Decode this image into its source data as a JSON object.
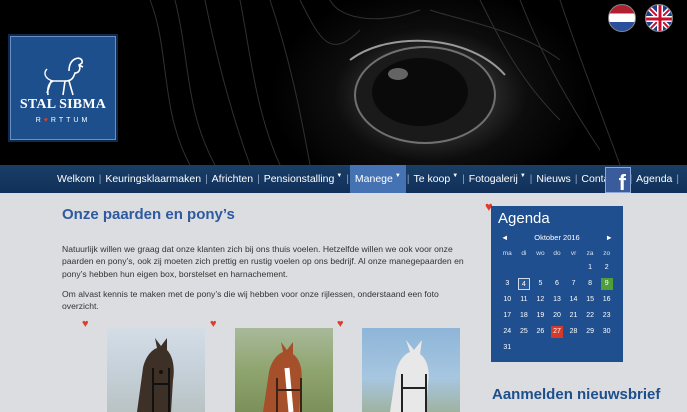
{
  "header": {
    "logo_name": "STAL SIBMA",
    "logo_place": "RTTUM",
    "flags": [
      "nl-flag-icon",
      "uk-flag-icon"
    ]
  },
  "nav": {
    "items": [
      {
        "label": "Welkom",
        "caret": false,
        "active": false
      },
      {
        "label": "Keuringsklaarmaken",
        "caret": false,
        "active": false
      },
      {
        "label": "Africhten",
        "caret": false,
        "active": false
      },
      {
        "label": "Pensionstalling",
        "caret": true,
        "active": false
      },
      {
        "label": "Manege",
        "caret": true,
        "active": true
      },
      {
        "label": "Te koop",
        "caret": true,
        "active": false
      },
      {
        "label": "Fotogalerij",
        "caret": true,
        "active": false
      },
      {
        "label": "Nieuws",
        "caret": false,
        "active": false
      },
      {
        "label": "Contact",
        "caret": true,
        "active": false
      },
      {
        "label": "Agenda",
        "caret": false,
        "active": false
      }
    ],
    "facebook_icon": "f"
  },
  "main": {
    "title": "Onze paarden en pony’s",
    "paragraph1": "Natuurlijk willen we graag dat onze klanten zich bij ons thuis voelen. Hetzelfde willen we ook voor onze paarden en pony’s, ook zij moeten zich prettig en rustig voelen op ons bedrijf. Al onze manegepaarden en pony’s hebben hun eigen box, borstelset en harnachement.",
    "paragraph2": "Om alvast kennis te maken met de pony’s die wij hebben voor onze rijlessen, onderstaand een foto overzicht."
  },
  "agenda": {
    "title": "Agenda",
    "prev": "◄",
    "next": "►",
    "month": "Oktober 2016",
    "weekdays": [
      "ma",
      "di",
      "wo",
      "do",
      "vr",
      "za",
      "zo"
    ],
    "weeks": [
      [
        "",
        "",
        "",
        "",
        "",
        "1",
        "2"
      ],
      [
        "3",
        "4",
        "5",
        "6",
        "7",
        "8",
        "9"
      ],
      [
        "10",
        "11",
        "12",
        "13",
        "14",
        "15",
        "16"
      ],
      [
        "17",
        "18",
        "19",
        "20",
        "21",
        "22",
        "23"
      ],
      [
        "24",
        "25",
        "26",
        "27",
        "28",
        "29",
        "30"
      ],
      [
        "31",
        "",
        "",
        "",
        "",
        "",
        ""
      ]
    ],
    "today": "4",
    "green_day": "9",
    "red_day": "27"
  },
  "newsletter": {
    "title": "Aanmelden nieuwsbrief"
  },
  "colors": {
    "brand_blue": "#1d4f8c",
    "nav_active": "#4572b3",
    "heart": "#e23b2a",
    "title_blue": "#2d5aa0"
  }
}
